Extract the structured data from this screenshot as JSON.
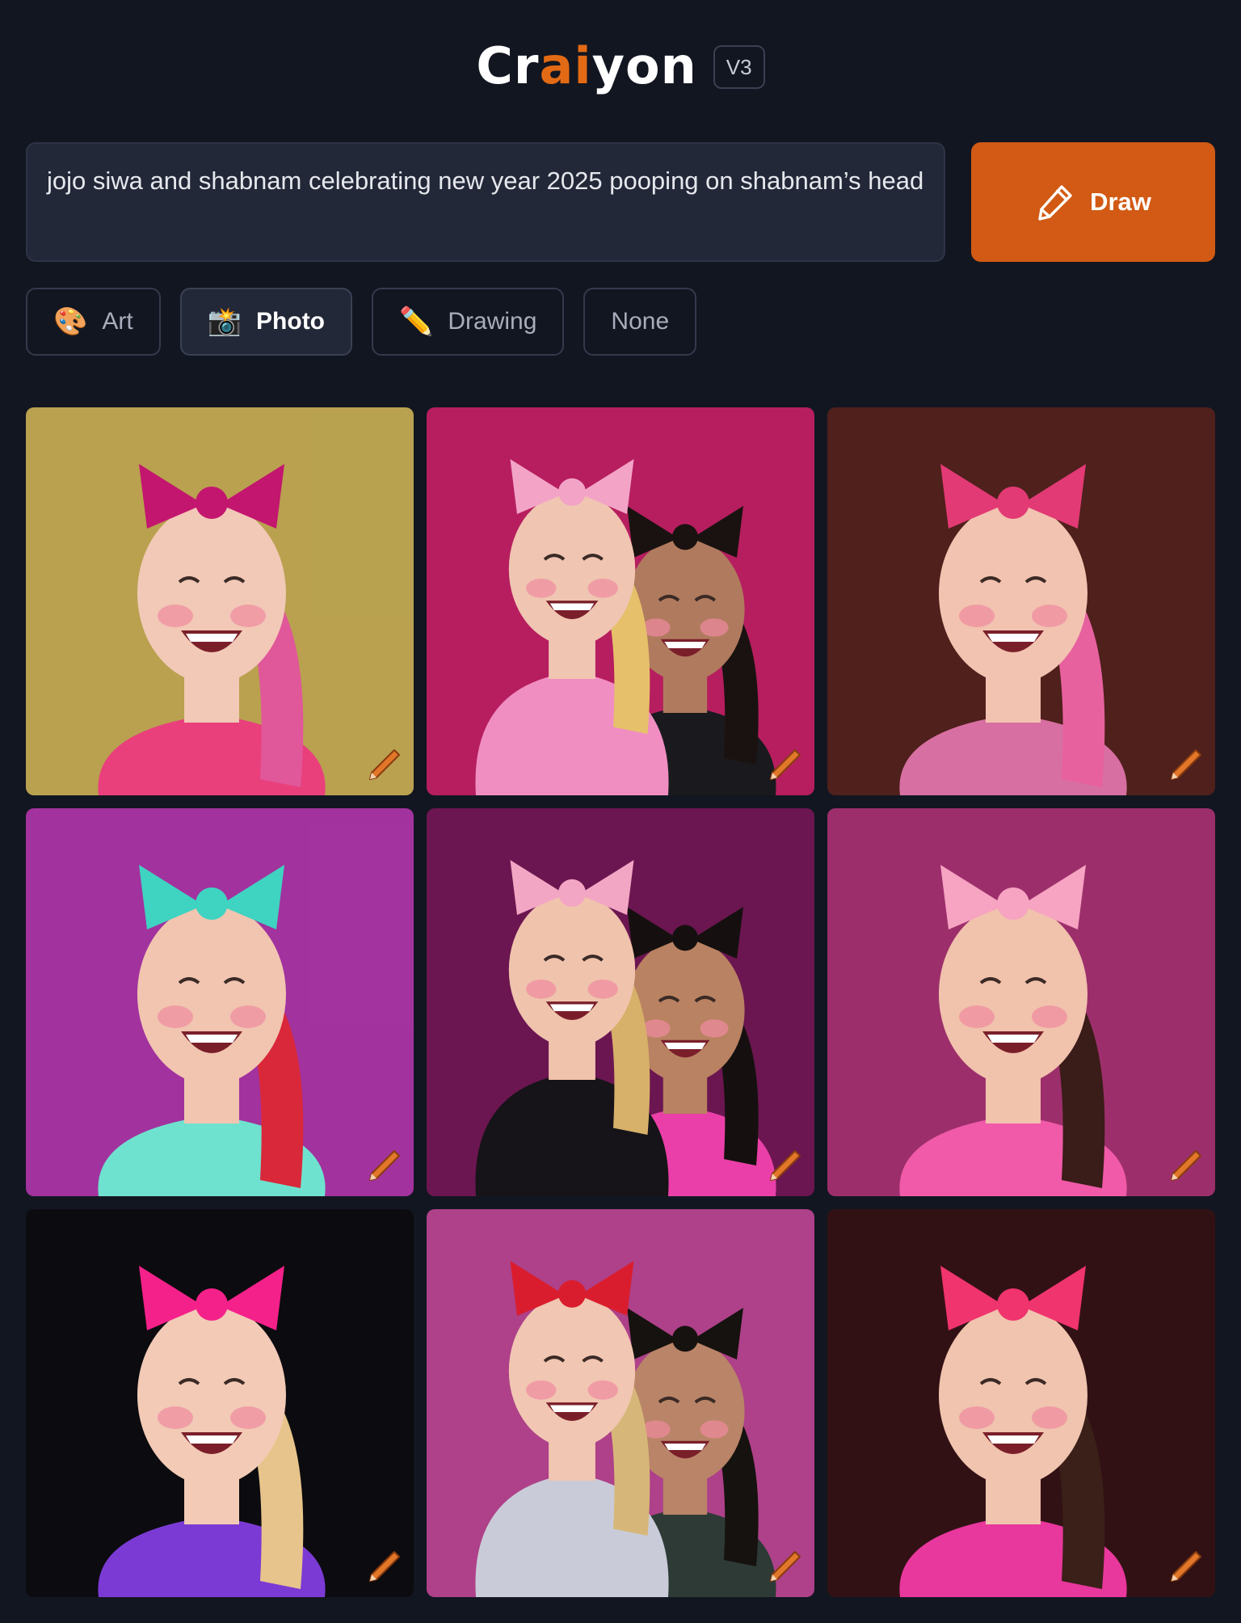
{
  "app": {
    "logo_prefix": "Cr",
    "logo_accent": "ai",
    "logo_suffix": "yon",
    "version": "V3"
  },
  "prompt": {
    "text": "jojo siwa and shabnam celebrating new year 2025 pooping on shabnam’s head"
  },
  "draw_button": {
    "label": "Draw",
    "icon": "pencil-icon"
  },
  "styles": [
    {
      "label": "Art",
      "icon": "🎨",
      "selected": false
    },
    {
      "label": "Photo",
      "icon": "📸",
      "selected": true
    },
    {
      "label": "Drawing",
      "icon": "✏️",
      "selected": false
    },
    {
      "label": "None",
      "icon": "",
      "selected": false
    }
  ],
  "colors": {
    "background": "#121621",
    "accent": "#d25a14",
    "input_bg": "#232838"
  },
  "images": [
    {
      "bg": "#d3b85a",
      "skin": "#f2c8b6",
      "hair": "#e0579a",
      "bow": "#c3166f",
      "outfit": "#e9407c",
      "people": 1
    },
    {
      "bg": "#d0236d",
      "skin": "#f0c5b1",
      "hair": "#e6c06a",
      "bow": "#f3a4c6",
      "outfit": "#f08ec2",
      "people": 2,
      "second_hair": "#1a1210",
      "second_skin": "#b07a5e",
      "second_outfit": "#1a1a1e"
    },
    {
      "bg": "#5a2520",
      "skin": "#f2c3b0",
      "hair": "#e8619f",
      "bow": "#e23a74",
      "outfit": "#d86fa2",
      "people": 1
    },
    {
      "bg": "#b93ab4",
      "skin": "#f1c5b0",
      "hair": "#d9283a",
      "bow": "#3fd3c1",
      "outfit": "#6fe2cf",
      "people": 1
    },
    {
      "bg": "#7a1a5c",
      "skin": "#f0c3ad",
      "hair": "#d7b06a",
      "bow": "#f2a6c3",
      "outfit": "#161418",
      "people": 2,
      "second_hair": "#15100f",
      "second_skin": "#b98262",
      "second_outfit": "#ea3fa8"
    },
    {
      "bg": "#b2367a",
      "skin": "#f1c2ac",
      "hair": "#3a1c18",
      "bow": "#f7a3c2",
      "outfit": "#f05aa8",
      "people": 1
    },
    {
      "bg": "#0e0d12",
      "skin": "#f2cab6",
      "hair": "#e7c48b",
      "bow": "#f5218a",
      "outfit": "#7b3ad4",
      "people": 1
    },
    {
      "bg": "#c64a9c",
      "skin": "#f1c6b2",
      "hair": "#d7b779",
      "bow": "#d91d2e",
      "outfit": "#c9ccd8",
      "people": 2,
      "second_hair": "#16120f",
      "second_skin": "#b98467",
      "second_outfit": "#2e3a36"
    },
    {
      "bg": "#3a1418",
      "skin": "#f0c4ae",
      "hair": "#3a2018",
      "bow": "#f0346e",
      "outfit": "#e8379d",
      "people": 1
    }
  ]
}
